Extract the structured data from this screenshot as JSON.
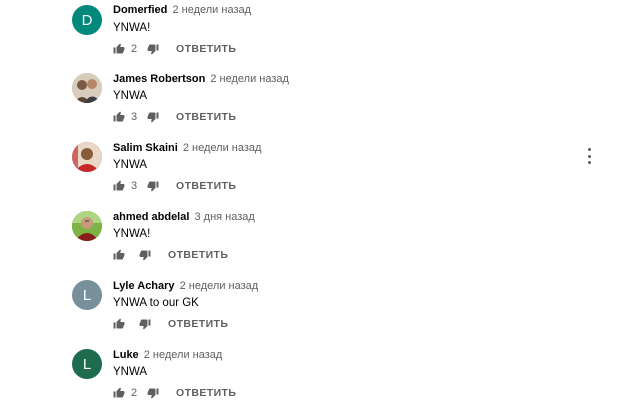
{
  "colors": {
    "text": "#030303",
    "secondary": "#606060",
    "avatar_teal": "#00897b",
    "avatar_grey": "#78909c",
    "avatar_green": "#1e6b4f"
  },
  "comments": [
    {
      "avatar_letter": "D",
      "author": "Domerfied",
      "time": "2 недели назад",
      "text": "YNWA!",
      "likes": "2",
      "reply_label": "ОТВЕТИТЬ"
    },
    {
      "avatar_letter": "",
      "author": "James Robertson",
      "time": "2 недели назад",
      "text": "YNWA",
      "likes": "3",
      "reply_label": "ОТВЕТИТЬ"
    },
    {
      "avatar_letter": "",
      "author": "Salim Skaini",
      "time": "2 недели назад",
      "text": "YNWA",
      "likes": "3",
      "reply_label": "ОТВЕТИТЬ"
    },
    {
      "avatar_letter": "",
      "author": "ahmed abdelal",
      "time": "3 дня назад",
      "text": "YNWA!",
      "likes": "",
      "reply_label": "ОТВЕТИТЬ"
    },
    {
      "avatar_letter": "L",
      "author": "Lyle Achary",
      "time": "2 недели назад",
      "text": "YNWA to our GK",
      "likes": "",
      "reply_label": "ОТВЕТИТЬ"
    },
    {
      "avatar_letter": "L",
      "author": "Luke",
      "time": "2 недели назад",
      "text": "YNWA",
      "likes": "2",
      "reply_label": "ОТВЕТИТЬ"
    }
  ],
  "icons": {
    "like": "thumb-up-icon",
    "dislike": "thumb-down-icon",
    "menu": "more-vert-icon"
  }
}
